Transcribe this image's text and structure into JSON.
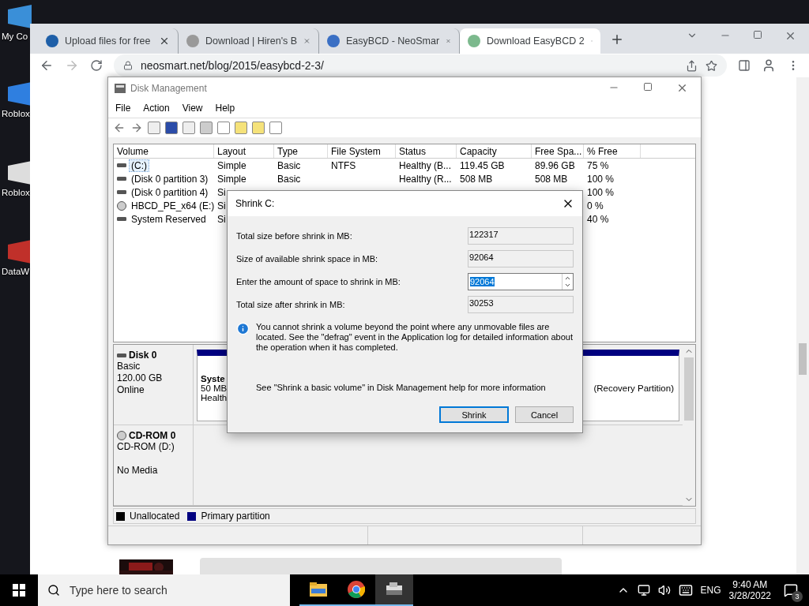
{
  "desktop_icons": [
    {
      "label": "My Co"
    },
    {
      "label": "Roblox"
    },
    {
      "label": "Roblox"
    },
    {
      "label": "DataW"
    }
  ],
  "browser": {
    "tabs": [
      {
        "title": "Upload files for free",
        "selected": false
      },
      {
        "title": "Download | Hiren's B",
        "selected": false
      },
      {
        "title": "EasyBCD - NeoSmar",
        "selected": false
      },
      {
        "title": "Download EasyBCD 2",
        "selected": true
      }
    ],
    "address": "neosmart.net/blog/2015/easybcd-2-3/"
  },
  "disk_management": {
    "title": "Disk Management",
    "menu": [
      "File",
      "Action",
      "View",
      "Help"
    ],
    "table": {
      "columns": [
        "Volume",
        "Layout",
        "Type",
        "File System",
        "Status",
        "Capacity",
        "Free Spa...",
        "% Free"
      ],
      "rows": [
        {
          "kind": "disk",
          "selected": true,
          "cells": [
            "(C:)",
            "Simple",
            "Basic",
            "NTFS",
            "Healthy (B...",
            "119.45 GB",
            "89.96 GB",
            "75 %"
          ]
        },
        {
          "kind": "disk",
          "selected": false,
          "cells": [
            "(Disk 0 partition 3)",
            "Simple",
            "Basic",
            null,
            "Healthy (R...",
            "508 MB",
            "508 MB",
            "100 %"
          ]
        },
        {
          "kind": "disk",
          "selected": false,
          "cells": [
            "(Disk 0 partition 4)",
            "Si",
            null,
            null,
            null,
            null,
            null,
            "100 %"
          ]
        },
        {
          "kind": "cdrom",
          "selected": false,
          "cells": [
            "HBCD_PE_x64 (E:)",
            "Si",
            null,
            null,
            null,
            null,
            null,
            "0 %"
          ]
        },
        {
          "kind": "disk",
          "selected": false,
          "cells": [
            "System Reserved",
            "Si",
            null,
            null,
            null,
            null,
            null,
            "40 %"
          ]
        }
      ]
    },
    "disks": [
      {
        "kind": "disk",
        "name": "Disk 0",
        "lines": [
          "Basic",
          "120.00 GB",
          "Online"
        ],
        "partitions": [
          {
            "lines": [
              "Syste",
              "50 MB",
              "Health"
            ]
          },
          {
            "lines": [
              "(Recovery Partition)"
            ]
          }
        ]
      },
      {
        "kind": "cdrom",
        "name": "CD-ROM 0",
        "lines": [
          "CD-ROM (D:)",
          "No Media"
        ]
      }
    ],
    "legend": [
      {
        "label": "Unallocated",
        "color": "#000000"
      },
      {
        "label": "Primary partition",
        "color": "#000080"
      }
    ]
  },
  "dialog": {
    "title": "Shrink C:",
    "fields": [
      {
        "kind": "readonly",
        "label": "Total size before shrink in MB:",
        "value": "122317"
      },
      {
        "kind": "readonly",
        "label": "Size of available shrink space in MB:",
        "value": "92064"
      },
      {
        "kind": "spin",
        "label": "Enter the amount of space to shrink in MB:",
        "value": "92064",
        "selected": true
      },
      {
        "kind": "readonly",
        "label": "Total size after shrink in MB:",
        "value": "30253"
      }
    ],
    "info": "You cannot shrink a volume beyond the point where any unmovable files are located. See the \"defrag\" event in the Application log for detailed information about the operation when it has completed.",
    "help": "See \"Shrink a basic volume\" in Disk Management help for more information",
    "buttons": [
      {
        "label": "Shrink",
        "default": true
      },
      {
        "label": "Cancel",
        "default": false
      }
    ]
  },
  "taskbar": {
    "search_placeholder": "Type here to search",
    "apps": [
      {
        "kind": "folder",
        "selected": false
      },
      {
        "kind": "chrome",
        "selected": false
      },
      {
        "kind": "tool",
        "selected": true
      }
    ],
    "language": "ENG",
    "time": "9:40 AM",
    "date": "3/28/2022",
    "notifications": "3"
  }
}
